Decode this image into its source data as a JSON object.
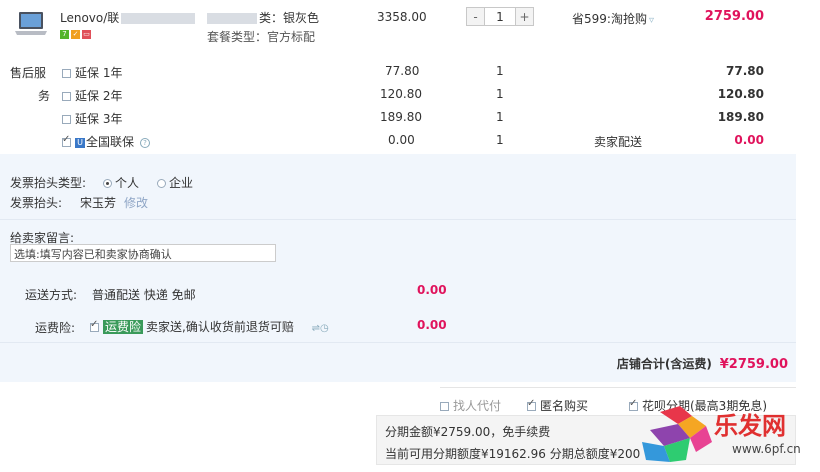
{
  "product": {
    "name_prefix": "Lenovo/联",
    "color_label": "类：银灰色",
    "package_label": "套餐类型：官方标配",
    "unit_price": "3358.00",
    "quantity": "1",
    "minus": "-",
    "plus": "+",
    "discount": "省599:淘抢购",
    "total": "2759.00",
    "badges": [
      {
        "text": "7",
        "color": "#53b42a"
      },
      {
        "text": "✓",
        "color": "#f0a020"
      },
      {
        "text": "▭",
        "color": "#e0505a"
      }
    ]
  },
  "after_sales": {
    "label_line1": "售后服",
    "label_line2": "务",
    "items": [
      {
        "name": "延保 1年",
        "price": "77.80",
        "qty": "1",
        "total": "77.80",
        "checked": false
      },
      {
        "name": "延保 2年",
        "price": "120.80",
        "qty": "1",
        "total": "120.80",
        "checked": false
      },
      {
        "name": "延保 3年",
        "price": "189.80",
        "qty": "1",
        "total": "189.80",
        "checked": false
      },
      {
        "name": "全国联保",
        "price": "0.00",
        "qty": "1",
        "delivery": "卖家配送",
        "total": "0.00",
        "checked": true
      }
    ]
  },
  "invoice": {
    "type_label": "发票抬头类型:",
    "opt_personal": "个人",
    "opt_company": "企业",
    "title_label": "发票抬头:",
    "title_value": "宋玉芳",
    "edit": "修改"
  },
  "message": {
    "label": "给卖家留言:",
    "placeholder": "选填:填写内容已和卖家协商确认"
  },
  "shipping": {
    "label": "运送方式:",
    "value": "普通配送 快递 免邮",
    "cost": "0.00"
  },
  "insurance": {
    "label": "运费险:",
    "tag": "运费险",
    "desc": "卖家送,确认收货前退货可赔",
    "cost": "0.00"
  },
  "shop_total": {
    "label": "店铺合计(含运费)",
    "value": "¥2759.00"
  },
  "options": {
    "pay_for_me": "找人代付",
    "anonymous": "匿名购买",
    "installment": "花呗分期(最高3期免息)"
  },
  "installment_panel": {
    "line1": "分期金额¥2759.00，免手续费",
    "line2": "当前可用分期额度¥19162.96 分期总额度¥2",
    "line2_tail": "00"
  },
  "watermark": {
    "brand": "乐发网",
    "url": "www.6pf.cn"
  },
  "colors": {
    "accent": "#e0135c",
    "panel_bg": "#f1f6fc"
  }
}
